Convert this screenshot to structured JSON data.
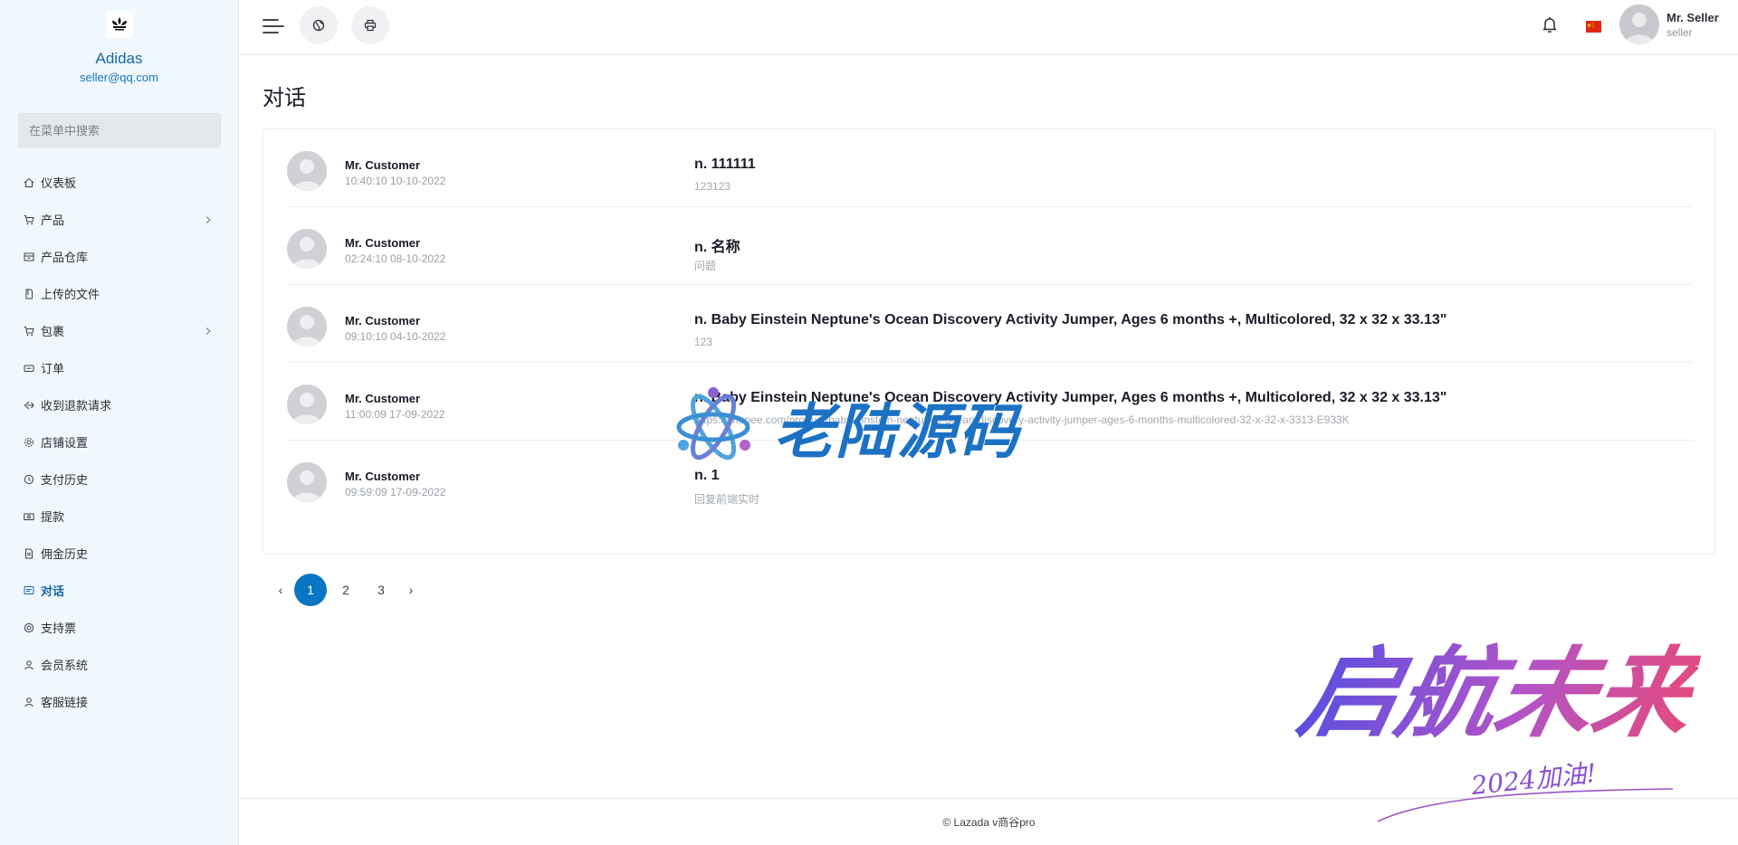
{
  "sidebar": {
    "brand_name": "Adidas",
    "brand_email": "seller@qq.com",
    "search_placeholder": "在菜单中搜索",
    "items": [
      {
        "label": "仪表板",
        "icon": "home-icon"
      },
      {
        "label": "产品",
        "icon": "cart-icon",
        "has_submenu": true
      },
      {
        "label": "产品仓库",
        "icon": "archive-icon"
      },
      {
        "label": "上传的文件",
        "icon": "file-icon"
      },
      {
        "label": "包裹",
        "icon": "cart-icon",
        "has_submenu": true
      },
      {
        "label": "订单",
        "icon": "ticket-icon"
      },
      {
        "label": "收到退款请求",
        "icon": "refund-icon"
      },
      {
        "label": "店铺设置",
        "icon": "gear-icon"
      },
      {
        "label": "支付历史",
        "icon": "history-icon"
      },
      {
        "label": "提款",
        "icon": "money-icon"
      },
      {
        "label": "佣金历史",
        "icon": "document-icon"
      },
      {
        "label": "对话",
        "icon": "chat-icon",
        "active": true
      },
      {
        "label": "支持票",
        "icon": "support-icon"
      },
      {
        "label": "会员系统",
        "icon": "user-icon"
      },
      {
        "label": "客服链接",
        "icon": "user-icon"
      }
    ]
  },
  "header": {
    "user_name": "Mr. Seller",
    "user_role": "seller"
  },
  "main": {
    "title": "对话",
    "conversations": [
      {
        "name": "Mr. Customer",
        "time": "10:40:10 10-10-2022",
        "subject": "n. 111111",
        "message": "123123"
      },
      {
        "name": "Mr. Customer",
        "time": "02:24:10 08-10-2022",
        "subject": "n. 名称",
        "message": "问题"
      },
      {
        "name": "Mr. Customer",
        "time": "09:10:10 04-10-2022",
        "subject": "n. Baby Einstein Neptune's Ocean Discovery Activity Jumper, Ages 6 months +, Multicolored, 32 x 32 x 33.13\"",
        "message": "123"
      },
      {
        "name": "Mr. Customer",
        "time": "11:00:09 17-09-2022",
        "subject": "n. Baby Einstein Neptune's Ocean Discovery Activity Jumper, Ages 6 months +, Multicolored, 32 x 32 x 33.13\"",
        "message": "https://shopee.com/product/baby-einstein-neptunes-ocean-discovery-activity-jumper-ages-6-months-multicolored-32-x-32-x-3313-E933K"
      },
      {
        "name": "Mr. Customer",
        "time": "09:59:09 17-09-2022",
        "subject": "n. 1",
        "message": "回复前端实时"
      }
    ]
  },
  "pagination": {
    "prev": "‹",
    "pages": [
      "1",
      "2",
      "3"
    ],
    "current": "1",
    "next": "›"
  },
  "footer": {
    "text": "© Lazada v商谷pro"
  },
  "watermarks": {
    "center": "老陆源码",
    "corner": "启航未来",
    "corner_sub": "2024加油!"
  },
  "colors": {
    "accent": "#0a75c2",
    "sidebar_bg": "#f0f8fd",
    "brand": "#1566a6"
  }
}
